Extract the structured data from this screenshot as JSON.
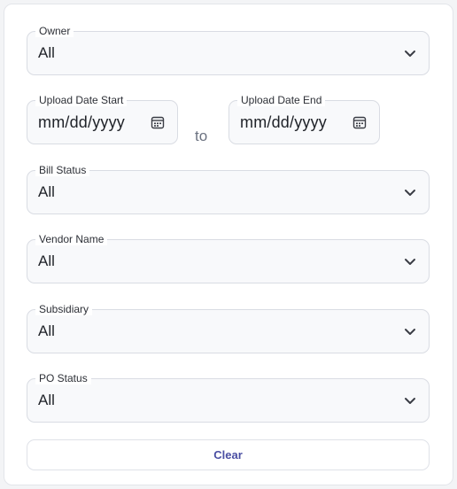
{
  "filters": {
    "owner": {
      "label": "Owner",
      "value": "All"
    },
    "upload_date_start": {
      "label": "Upload Date Start",
      "placeholder": "mm/dd/yyyy"
    },
    "range_separator": "to",
    "upload_date_end": {
      "label": "Upload Date End",
      "placeholder": "mm/dd/yyyy"
    },
    "bill_status": {
      "label": "Bill Status",
      "value": "All"
    },
    "vendor_name": {
      "label": "Vendor Name",
      "value": "All"
    },
    "subsidiary": {
      "label": "Subsidiary",
      "value": "All"
    },
    "po_status": {
      "label": "PO Status",
      "value": "All"
    }
  },
  "actions": {
    "clear_label": "Clear"
  },
  "icons": {
    "dropdown": "chevron-down-icon",
    "date": "calendar-icon"
  },
  "colors": {
    "accent": "#4b4fa3"
  }
}
